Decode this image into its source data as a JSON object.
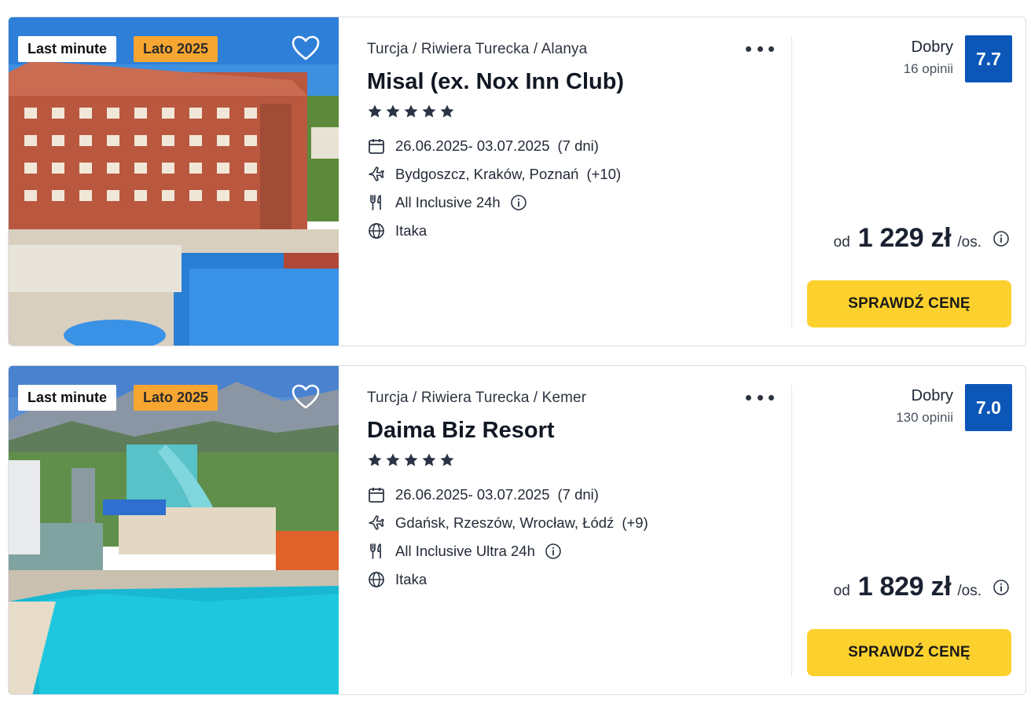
{
  "offers": [
    {
      "badges": {
        "last_minute": "Last minute",
        "season": "Lato 2025"
      },
      "breadcrumb": "Turcja / Riwiera Turecka / Alanya",
      "name": "Misal (ex. Nox Inn Club)",
      "stars": 5,
      "dates": "26.06.2025- 03.07.2025",
      "duration": "(7 dni)",
      "departures": "Bydgoszcz, Kraków, Poznań",
      "departures_more": "(+10)",
      "board": "All Inclusive 24h",
      "operator": "Itaka",
      "rating_label": "Dobry",
      "reviews": "16 opinii",
      "score": "7.7",
      "price_prefix": "od",
      "price": "1 229 zł",
      "price_suffix": "/os.",
      "cta": "SPRAWDŹ CENĘ"
    },
    {
      "badges": {
        "last_minute": "Last minute",
        "season": "Lato 2025"
      },
      "breadcrumb": "Turcja / Riwiera Turecka / Kemer",
      "name": "Daima Biz Resort",
      "stars": 5,
      "dates": "26.06.2025- 03.07.2025",
      "duration": "(7 dni)",
      "departures": "Gdańsk, Rzeszów, Wrocław, Łódź",
      "departures_more": "(+9)",
      "board": "All Inclusive Ultra 24h",
      "operator": "Itaka",
      "rating_label": "Dobry",
      "reviews": "130 opinii",
      "score": "7.0",
      "price_prefix": "od",
      "price": "1 829 zł",
      "price_suffix": "/os.",
      "cta": "SPRAWDŹ CENĘ"
    }
  ],
  "colors": {
    "score_bg": "#0c56b8",
    "cta_bg": "#fdd12d",
    "season_badge": "#f7a631"
  },
  "icons": [
    "heart-icon",
    "more-icon",
    "star-icon",
    "calendar-icon",
    "plane-icon",
    "cutlery-icon",
    "info-icon",
    "globe-icon"
  ]
}
